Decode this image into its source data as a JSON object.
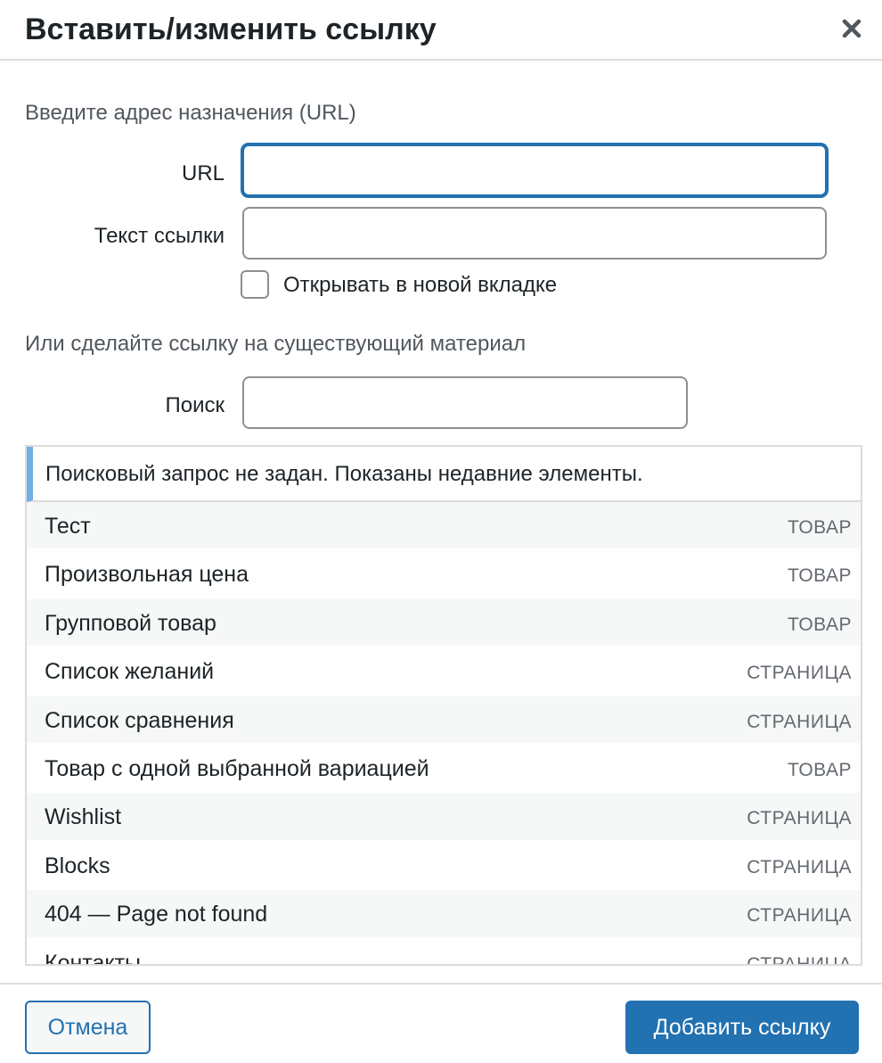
{
  "dialog": {
    "title": "Вставить/изменить ссылку",
    "close_icon": "close-icon"
  },
  "url_section": {
    "heading": "Введите адрес назначения (URL)",
    "url_label": "URL",
    "url_value": "",
    "link_text_label": "Текст ссылки",
    "link_text_value": "",
    "new_tab_label": "Открывать в новой вкладке",
    "new_tab_checked": false
  },
  "existing_section": {
    "heading": "Или сделайте ссылку на существующий материал",
    "search_label": "Поиск",
    "search_value": ""
  },
  "results": {
    "notice": "Поисковый запрос не задан. Показаны недавние элементы.",
    "items": [
      {
        "title": "Тест",
        "type": "ТОВАР"
      },
      {
        "title": "Произвольная цена",
        "type": "ТОВАР"
      },
      {
        "title": "Групповой товар",
        "type": "ТОВАР"
      },
      {
        "title": "Список желаний",
        "type": "СТРАНИЦА"
      },
      {
        "title": "Список сравнения",
        "type": "СТРАНИЦА"
      },
      {
        "title": "Товар с одной выбранной вариацией",
        "type": "ТОВАР"
      },
      {
        "title": "Wishlist",
        "type": "СТРАНИЦА"
      },
      {
        "title": "Blocks",
        "type": "СТРАНИЦА"
      },
      {
        "title": "404 — Page not found",
        "type": "СТРАНИЦА"
      },
      {
        "title": "Контакты",
        "type": "СТРАНИЦА"
      }
    ]
  },
  "footer": {
    "cancel_label": "Отмена",
    "submit_label": "Добавить ссылку"
  },
  "colors": {
    "accent": "#2271b1",
    "notice_border": "#72aee6",
    "row_alt": "#f6f7f7"
  }
}
